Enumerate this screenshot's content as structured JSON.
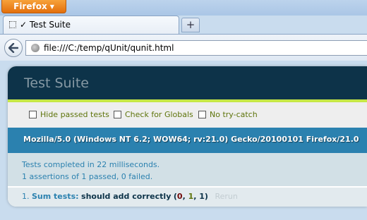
{
  "browser": {
    "app_button_label": "Firefox",
    "tab_title": "Test Suite",
    "tab_check": "✓",
    "new_tab_label": "+",
    "url": "file:///C:/temp/qUnit/qunit.html"
  },
  "page": {
    "header": "Test Suite",
    "options": [
      "Hide passed tests",
      "Check for Globals",
      "No try-catch"
    ],
    "user_agent": "Mozilla/5.0 (Windows NT 6.2; WOW64; rv:21.0) Gecko/20100101 Firefox/21.0",
    "result_line1": "Tests completed in 22 milliseconds.",
    "result_line2": "1 assertions of 1 passed, 0 failed.",
    "test": {
      "number": "1.",
      "module": "Sum tests:",
      "name": "should add correctly",
      "open": "(",
      "failed": "0",
      "sep1": ", ",
      "passed": "1",
      "sep2": ", ",
      "total": "1",
      "close": ")",
      "rerun": "Rerun"
    }
  }
}
